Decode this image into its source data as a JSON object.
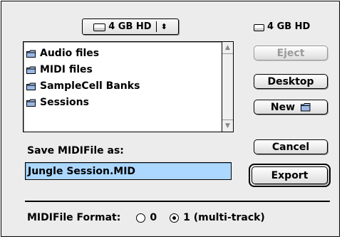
{
  "volume_popup": {
    "label": "4 GB HD",
    "icon": "hard-disk-icon",
    "arrows": "⬍"
  },
  "volume_label": {
    "text": "4 GB HD",
    "icon": "hard-disk-icon"
  },
  "file_list": {
    "items": [
      {
        "name": "Audio files",
        "icon": "folder-icon"
      },
      {
        "name": "MIDI files",
        "icon": "folder-icon"
      },
      {
        "name": "SampleCell Banks",
        "icon": "folder-icon"
      },
      {
        "name": "Sessions",
        "icon": "folder-icon"
      }
    ]
  },
  "buttons": {
    "eject": "Eject",
    "desktop": "Desktop",
    "new": "New",
    "cancel": "Cancel",
    "export": "Export"
  },
  "save": {
    "label": "Save MIDIFile as:",
    "filename": "Jungle Session.MID"
  },
  "format": {
    "label": "MIDIFile Format:",
    "options": [
      {
        "label": "0",
        "selected": false
      },
      {
        "label": "1 (multi-track)",
        "selected": true
      }
    ]
  },
  "colors": {
    "filename_highlight": "#acd8ff",
    "dialog_bg": "#ececec"
  }
}
